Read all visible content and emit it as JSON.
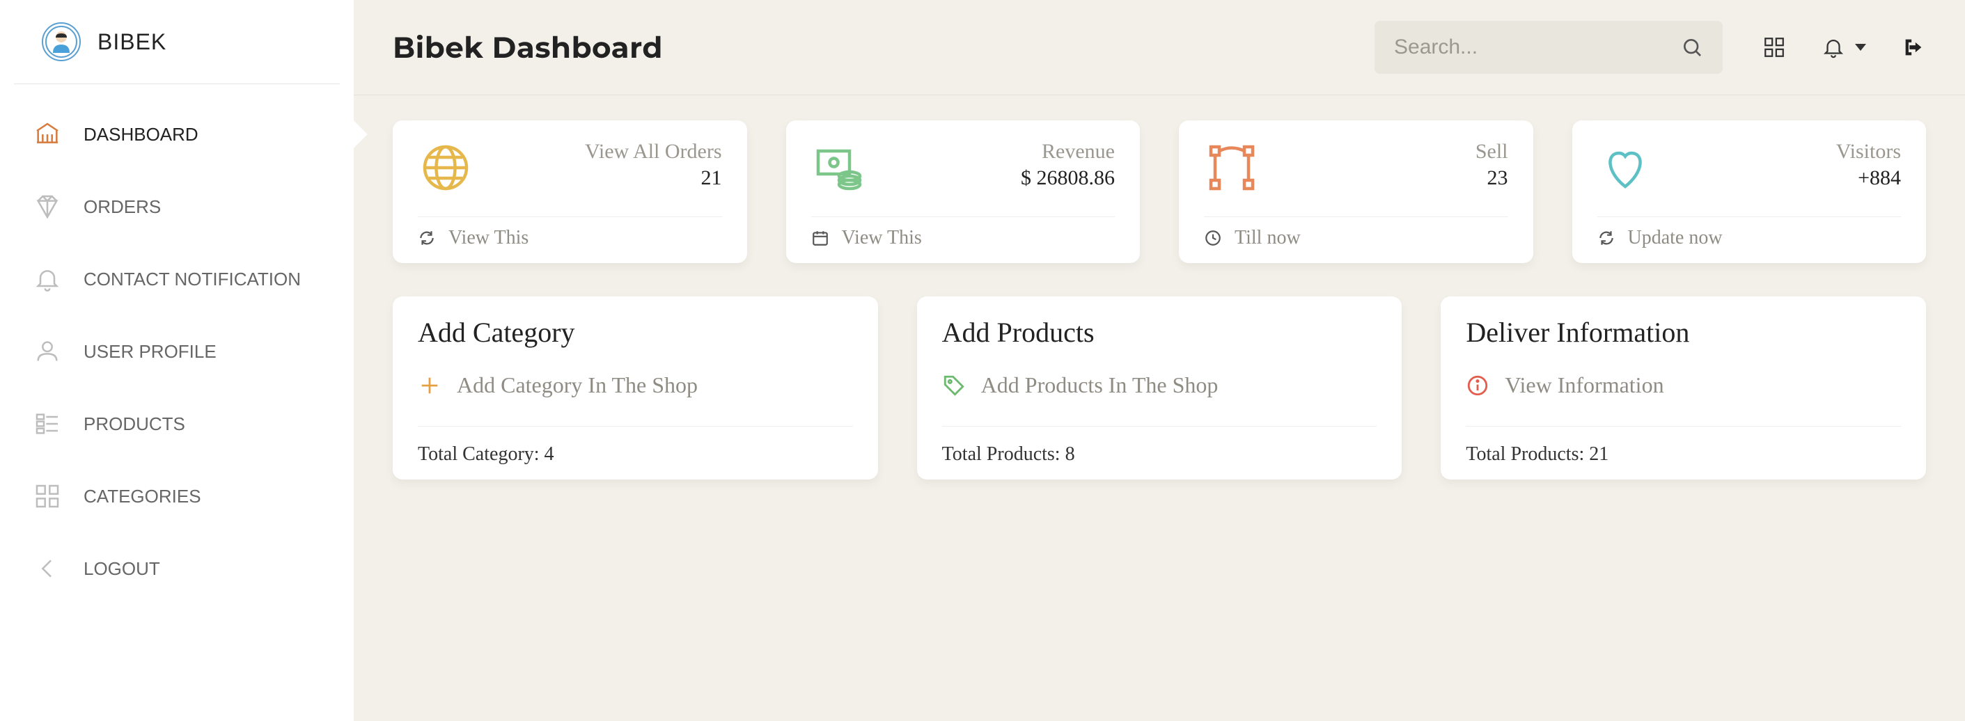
{
  "brand": "BIBEK",
  "page_title": "Bibek Dashboard",
  "search": {
    "placeholder": "Search..."
  },
  "sidebar": {
    "items": [
      {
        "label": "DASHBOARD"
      },
      {
        "label": "ORDERS"
      },
      {
        "label": "CONTACT NOTIFICATION"
      },
      {
        "label": "USER PROFILE"
      },
      {
        "label": "PRODUCTS"
      },
      {
        "label": "CATEGORIES"
      },
      {
        "label": "LOGOUT"
      }
    ]
  },
  "stats": {
    "orders": {
      "label": "View All Orders",
      "value": "21",
      "footer": "View This"
    },
    "revenue": {
      "label": "Revenue",
      "value": "$ 26808.86",
      "footer": "View This"
    },
    "sell": {
      "label": "Sell",
      "value": "23",
      "footer": "Till now"
    },
    "visitors": {
      "label": "Visitors",
      "value": "+884",
      "footer": "Update now"
    }
  },
  "actions": {
    "category": {
      "title": "Add Category",
      "link": "Add Category In The Shop",
      "total": "Total Category: 4"
    },
    "products": {
      "title": "Add Products",
      "link": "Add Products In The Shop",
      "total": "Total Products: 8"
    },
    "deliver": {
      "title": "Deliver Information",
      "link": "View Information",
      "total": "Total Products: 21"
    }
  }
}
